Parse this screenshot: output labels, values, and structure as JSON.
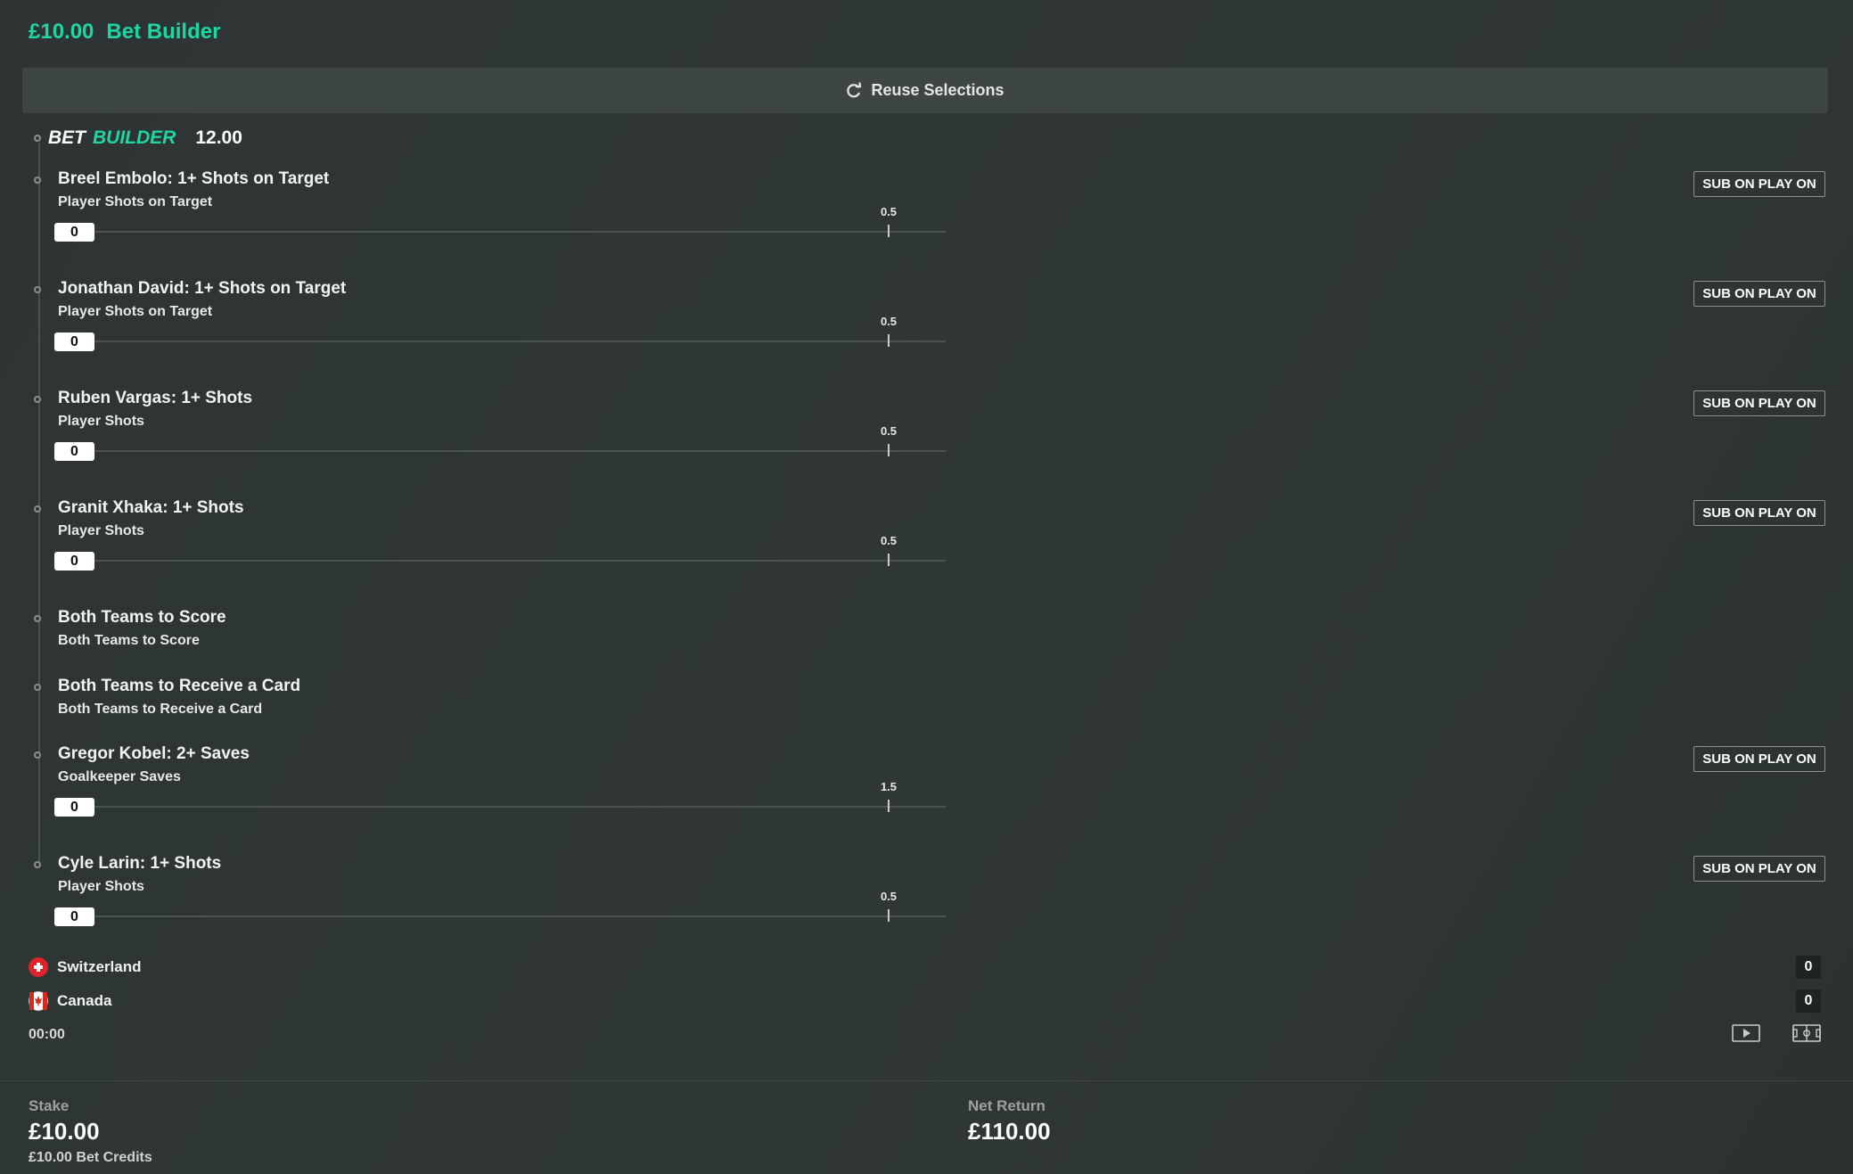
{
  "header": {
    "stake_amount": "£10.00",
    "title": "Bet Builder"
  },
  "reuse": {
    "label": "Reuse Selections",
    "icon": "refresh-icon"
  },
  "bet_builder": {
    "bet_word": "BET",
    "builder_word": "BUILDER",
    "odds": "12.00"
  },
  "selections": [
    {
      "title": "Breel Embolo: 1+ Shots on Target",
      "market": "Player Shots on Target",
      "has_sub": true,
      "sub_label": "SUB ON PLAY ON",
      "current": "0",
      "target": "0.5"
    },
    {
      "title": "Jonathan David: 1+ Shots on Target",
      "market": "Player Shots on Target",
      "has_sub": true,
      "sub_label": "SUB ON PLAY ON",
      "current": "0",
      "target": "0.5"
    },
    {
      "title": "Ruben Vargas: 1+ Shots",
      "market": "Player Shots",
      "has_sub": true,
      "sub_label": "SUB ON PLAY ON",
      "current": "0",
      "target": "0.5"
    },
    {
      "title": "Granit Xhaka: 1+ Shots",
      "market": "Player Shots",
      "has_sub": true,
      "sub_label": "SUB ON PLAY ON",
      "current": "0",
      "target": "0.5"
    },
    {
      "title": "Both Teams to Score",
      "market": "Both Teams to Score",
      "has_sub": false
    },
    {
      "title": "Both Teams to Receive a Card",
      "market": "Both Teams to Receive a Card",
      "has_sub": false
    },
    {
      "title": "Gregor Kobel: 2+ Saves",
      "market": "Goalkeeper Saves",
      "has_sub": true,
      "sub_label": "SUB ON PLAY ON",
      "current": "0",
      "target": "1.5"
    },
    {
      "title": "Cyle Larin: 1+ Shots",
      "market": "Player Shots",
      "has_sub": true,
      "sub_label": "SUB ON PLAY ON",
      "current": "0",
      "target": "0.5"
    }
  ],
  "teams": [
    {
      "name": "Switzerland",
      "score": "0",
      "flag": "switzerland-flag-icon"
    },
    {
      "name": "Canada",
      "score": "0",
      "flag": "canada-flag-icon"
    }
  ],
  "match": {
    "time": "00:00",
    "icons": [
      "play-video-icon",
      "pitch-icon"
    ]
  },
  "footer": {
    "stake_label": "Stake",
    "stake_value": "£10.00",
    "bet_credits": "£10.00 Bet Credits",
    "return_label": "Net Return",
    "return_value": "£110.00"
  },
  "colors": {
    "accent": "#1fd6a3",
    "background": "#2e3534"
  }
}
